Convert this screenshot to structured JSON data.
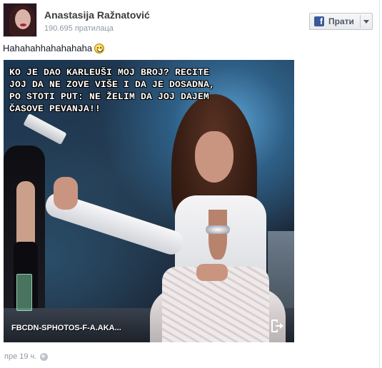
{
  "author": {
    "name": "Anastasija Ražnatović",
    "followers": "190.695 пратилаца"
  },
  "follow_button": {
    "label": "Прати",
    "icon": "facebook-f-icon"
  },
  "post": {
    "text": "Hahahahhahahahaha",
    "emoticon": "smiley-icon"
  },
  "photo": {
    "caption": "KO JE DAO KARLEUŠI MOJ BROJ? RECITE\nJOJ DA NE ZOVE VIŠE I DA JE DOSADNA,\nPO STOTI PUT: NE ŽELIM DA JOJ DAJEM\nČASOVE PEVANJA!!",
    "source": "FBCDN-SPHOTOS-F-A.AKA...",
    "share_icon": "share-out-icon"
  },
  "footer": {
    "timestamp": "пре 19 ч.",
    "privacy_icon": "globe-icon"
  },
  "colors": {
    "brand": "#3b5998",
    "muted": "#9197a3",
    "text": "#141823"
  }
}
